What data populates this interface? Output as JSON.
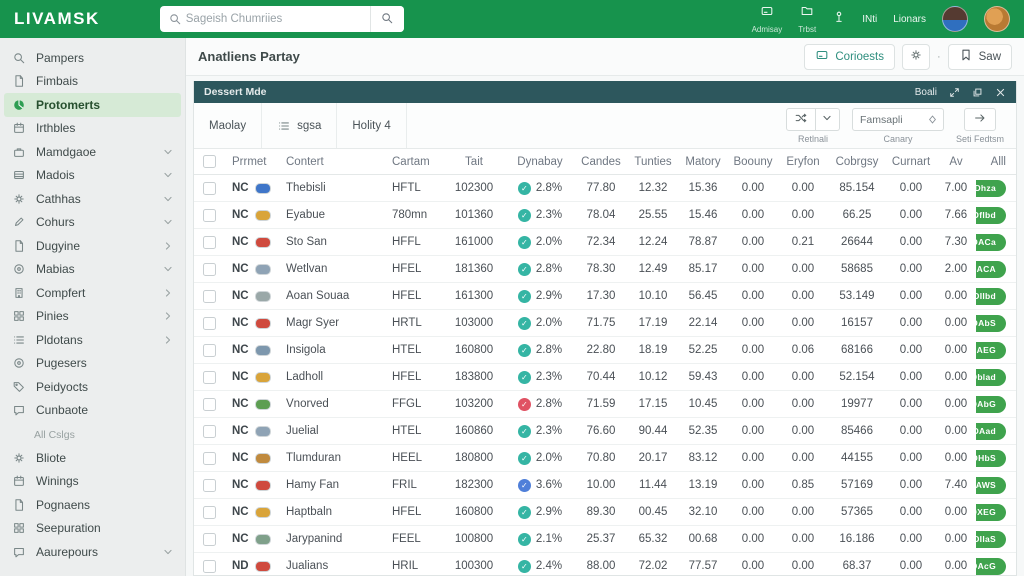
{
  "navbar": {
    "logo": "LIVAMSK",
    "search_placeholder": "Sageish Chumriies",
    "actions": [
      {
        "label": "Admisay",
        "icon": "card-icon"
      },
      {
        "label": "Trbst",
        "icon": "folder-icon"
      }
    ],
    "signal_label": "INti",
    "user_name": "Lionars"
  },
  "sidebar": {
    "items": [
      {
        "label": "Pampers",
        "icon": "search-icon",
        "chevron": ""
      },
      {
        "label": "Fimbais",
        "icon": "file-icon",
        "chevron": ""
      },
      {
        "label": "Protomerts",
        "icon": "pie-icon",
        "chevron": "",
        "active": true
      },
      {
        "label": "Irthbles",
        "icon": "calendar-icon",
        "chevron": ""
      },
      {
        "label": "Mamdgaoe",
        "icon": "briefcase-icon",
        "chevron": "down"
      },
      {
        "label": "Madois",
        "icon": "rows-icon",
        "chevron": "down"
      },
      {
        "label": "Cathhas",
        "icon": "gear-icon",
        "chevron": "down"
      },
      {
        "label": "Cohurs",
        "icon": "pen-icon",
        "chevron": "down"
      },
      {
        "label": "Dugyine",
        "icon": "file-icon",
        "chevron": "right"
      },
      {
        "label": "Mabias",
        "icon": "target-icon",
        "chevron": "down"
      },
      {
        "label": "Compfert",
        "icon": "building-icon",
        "chevron": "right"
      },
      {
        "label": "Pinies",
        "icon": "grid-icon",
        "chevron": "right"
      },
      {
        "label": "Pldotans",
        "icon": "list-icon",
        "chevron": "right"
      },
      {
        "label": "Pugesers",
        "icon": "target-icon",
        "chevron": ""
      },
      {
        "label": "Peidyocts",
        "icon": "tag-icon",
        "chevron": ""
      },
      {
        "label": "Cunbaote",
        "icon": "chat-icon",
        "chevron": ""
      }
    ],
    "section_label": "All Cslgs",
    "section_items": [
      {
        "label": "Bliote",
        "icon": "gear-icon",
        "chevron": ""
      },
      {
        "label": "Winings",
        "icon": "calendar-icon",
        "chevron": ""
      },
      {
        "label": "Pognaens",
        "icon": "file-icon",
        "chevron": ""
      },
      {
        "label": "Seepuration",
        "icon": "grid-icon",
        "chevron": ""
      },
      {
        "label": "Aaurepours",
        "icon": "chat-icon",
        "chevron": "down"
      }
    ]
  },
  "main": {
    "title": "Anatliens Partay",
    "buttons": {
      "contacts_label": "Corioests",
      "save_label": "Saw"
    },
    "panel": {
      "title": "Dessert Mde",
      "right_label": "Boali"
    },
    "toolbar": {
      "items": [
        "Maolay",
        "sgsa",
        "Holity 4"
      ],
      "controls": {
        "group_label": "Retlnali",
        "input_value": "Famsapli",
        "input_label": "Canary",
        "arrow_label": "Seti Fedtsm"
      }
    }
  },
  "table": {
    "columns": [
      "Prrmet",
      "Contert",
      "Cartam",
      "Tait",
      "Dynabay",
      "Candes",
      "Tunties",
      "Matory",
      "Boouny",
      "Eryfon",
      "Cobrgsy",
      "Curnart",
      "Av",
      "Alll"
    ],
    "badge_colors": {
      "teal": "#35b5a4",
      "red": "#e05263",
      "blue": "#4f7fd9"
    },
    "rows": [
      {
        "country": "NC",
        "flag": "#3f76c9",
        "name": "Thebisli",
        "code": "HFTL",
        "amount": "102300",
        "badge": "2.8%",
        "badge_color": "teal",
        "values": [
          "77.80",
          "12.32",
          "15.36",
          "0.00",
          "0.00",
          "85.154",
          "0.00"
        ],
        "av": "7.00",
        "action": "Dhza"
      },
      {
        "country": "NC",
        "flag": "#d9a43a",
        "name": "Eyabue",
        "code": "780mn",
        "amount": "101360",
        "badge": "2.3%",
        "badge_color": "teal",
        "values": [
          "78.04",
          "25.55",
          "15.46",
          "0.00",
          "0.00",
          "66.25",
          "0.00"
        ],
        "av": "7.66",
        "action": "Dflbd"
      },
      {
        "country": "NC",
        "flag": "#cf4a3e",
        "name": "Sto San",
        "code": "HFFL",
        "amount": "161000",
        "badge": "2.0%",
        "badge_color": "teal",
        "values": [
          "72.34",
          "12.24",
          "78.87",
          "0.00",
          "0.21",
          "26644",
          "0.00"
        ],
        "av": "7.30",
        "action": "DACa"
      },
      {
        "country": "NC",
        "flag": "#8fa3b5",
        "name": "Wetlvan",
        "code": "HFEL",
        "amount": "181360",
        "badge": "2.8%",
        "badge_color": "teal",
        "values": [
          "78.30",
          "12.49",
          "85.17",
          "0.00",
          "0.00",
          "58685",
          "0.00"
        ],
        "av": "2.00",
        "action": "DACA"
      },
      {
        "country": "NC",
        "flag": "#9aa8a8",
        "name": "Aoan Souaa",
        "code": "HFEL",
        "amount": "161300",
        "badge": "2.9%",
        "badge_color": "teal",
        "values": [
          "17.30",
          "10.10",
          "56.45",
          "0.00",
          "0.00",
          "53.149",
          "0.00"
        ],
        "av": "0.00",
        "action": "DIlbd"
      },
      {
        "country": "NC",
        "flag": "#cf4a3e",
        "name": "Magr Syer",
        "code": "HRTL",
        "amount": "103000",
        "badge": "2.0%",
        "badge_color": "teal",
        "values": [
          "71.75",
          "17.19",
          "22.14",
          "0.00",
          "0.00",
          "16157",
          "0.00"
        ],
        "av": "0.00",
        "action": "DAbS"
      },
      {
        "country": "NC",
        "flag": "#7d97ad",
        "name": "Insigola",
        "code": "HTEL",
        "amount": "160800",
        "badge": "2.8%",
        "badge_color": "teal",
        "values": [
          "22.80",
          "18.19",
          "52.25",
          "0.00",
          "0.06",
          "68166",
          "0.00"
        ],
        "av": "0.00",
        "action": "DAEG"
      },
      {
        "country": "NC",
        "flag": "#d9a43a",
        "name": "Ladholl",
        "code": "HFEL",
        "amount": "183800",
        "badge": "2.3%",
        "badge_color": "teal",
        "values": [
          "70.44",
          "10.12",
          "59.43",
          "0.00",
          "0.00",
          "52.154",
          "0.00"
        ],
        "av": "0.00",
        "action": "Dblad"
      },
      {
        "country": "NC",
        "flag": "#5d9e52",
        "name": "Vnorved",
        "code": "FFGL",
        "amount": "103200",
        "badge": "2.8%",
        "badge_color": "red",
        "values": [
          "71.59",
          "17.15",
          "10.45",
          "0.00",
          "0.00",
          "19977",
          "0.00"
        ],
        "av": "0.00",
        "action": "DAbG"
      },
      {
        "country": "NC",
        "flag": "#8fa3b5",
        "name": "Juelial",
        "code": "HTEL",
        "amount": "160860",
        "badge": "2.3%",
        "badge_color": "teal",
        "values": [
          "76.60",
          "90.44",
          "52.35",
          "0.00",
          "0.00",
          "85466",
          "0.00"
        ],
        "av": "0.00",
        "action": "DAad"
      },
      {
        "country": "NC",
        "flag": "#c08a3e",
        "name": "Tlumduran",
        "code": "HEEL",
        "amount": "180800",
        "badge": "2.0%",
        "badge_color": "teal",
        "values": [
          "70.80",
          "20.17",
          "83.12",
          "0.00",
          "0.00",
          "44155",
          "0.00"
        ],
        "av": "0.00",
        "action": "DHbS"
      },
      {
        "country": "NC",
        "flag": "#cf4a3e",
        "name": "Hamy Fan",
        "code": "FRIL",
        "amount": "182300",
        "badge": "3.6%",
        "badge_color": "blue",
        "values": [
          "10.00",
          "11.44",
          "13.19",
          "0.00",
          "0.85",
          "57169",
          "0.00"
        ],
        "av": "7.40",
        "action": "DAWS"
      },
      {
        "country": "NC",
        "flag": "#d9a43a",
        "name": "Haptbaln",
        "code": "HFEL",
        "amount": "160800",
        "badge": "2.9%",
        "badge_color": "teal",
        "values": [
          "89.30",
          "00.45",
          "32.10",
          "0.00",
          "0.00",
          "57365",
          "0.00"
        ],
        "av": "0.00",
        "action": "DXEG"
      },
      {
        "country": "NC",
        "flag": "#7fa08a",
        "name": "Jarypanind",
        "code": "FEEL",
        "amount": "100800",
        "badge": "2.1%",
        "badge_color": "teal",
        "values": [
          "25.37",
          "65.32",
          "00.68",
          "0.00",
          "0.00",
          "16.186",
          "0.00"
        ],
        "av": "0.00",
        "action": "DIlaS"
      },
      {
        "country": "ND",
        "flag": "#cf4a3e",
        "name": "Jualians",
        "code": "HRIL",
        "amount": "100300",
        "badge": "2.4%",
        "badge_color": "teal",
        "values": [
          "88.00",
          "72.02",
          "77.57",
          "0.00",
          "0.00",
          "68.37",
          "0.00"
        ],
        "av": "0.00",
        "action": "DAcG"
      }
    ]
  }
}
